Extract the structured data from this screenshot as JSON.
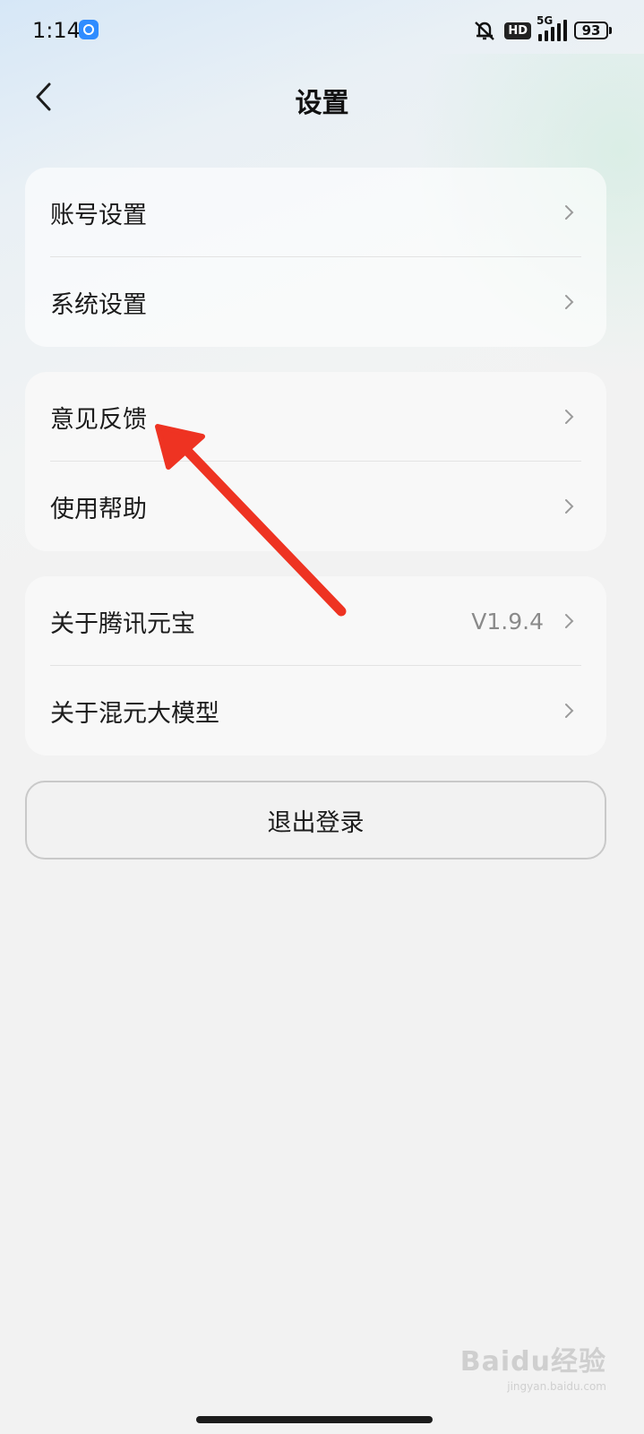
{
  "status_bar": {
    "time": "1:14",
    "network": "5G",
    "hd_badge": "HD",
    "battery": "93",
    "icons": [
      "app-icon",
      "mute-icon",
      "signal-icon",
      "battery-icon"
    ]
  },
  "header": {
    "title": "设置",
    "back_icon": "chevron-left-icon"
  },
  "groups": [
    {
      "items": [
        {
          "label": "账号设置"
        },
        {
          "label": "系统设置"
        }
      ]
    },
    {
      "items": [
        {
          "label": "意见反馈"
        },
        {
          "label": "使用帮助"
        }
      ]
    },
    {
      "items": [
        {
          "label": "关于腾讯元宝",
          "value": "V1.9.4"
        },
        {
          "label": "关于混元大模型"
        }
      ]
    }
  ],
  "logout": {
    "label": "退出登录"
  },
  "annotation": {
    "color": "#ee3322",
    "icon": "red-arrow-icon"
  },
  "watermark": {
    "main": "Baidu经验",
    "sub": "jingyan.baidu.com"
  },
  "colors": {
    "background": "#f2f2f2",
    "text": "#1c1c1c",
    "secondary": "#8a8a8a"
  }
}
